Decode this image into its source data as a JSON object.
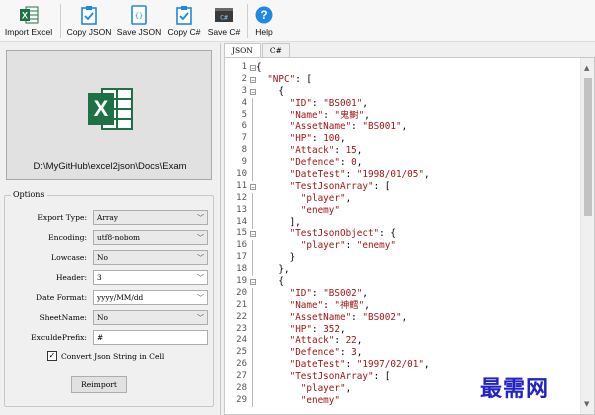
{
  "toolbar": {
    "buttons": [
      {
        "label": "Import Excel",
        "icon": "excel-icon"
      },
      {
        "label": "Copy JSON",
        "icon": "clipboard-check-icon"
      },
      {
        "label": "Save JSON",
        "icon": "json-file-icon"
      },
      {
        "label": "Copy C#",
        "icon": "clipboard-check-icon"
      },
      {
        "label": "Save C#",
        "icon": "csharp-file-icon"
      },
      {
        "label": "Help",
        "icon": "help-icon"
      }
    ]
  },
  "dropzone": {
    "path": "D:\\MyGitHub\\excel2json\\Docs\\Exam",
    "icon": "excel-logo-icon"
  },
  "options": {
    "legend": "Options",
    "export_type": {
      "label": "Export Type:",
      "value": "Array"
    },
    "encoding": {
      "label": "Encoding:",
      "value": "utf8-nobom"
    },
    "lowcase": {
      "label": "Lowcase:",
      "value": "No"
    },
    "header": {
      "label": "Header:",
      "value": "3"
    },
    "date_format": {
      "label": "Date Format:",
      "value": "yyyy/MM/dd"
    },
    "sheet_name": {
      "label": "SheetName:",
      "value": "No"
    },
    "exclude_prefix": {
      "label": "ExculdePrefix:",
      "value": "#"
    },
    "convert_json": {
      "label": "Convert Json String in Cell",
      "checked": true
    },
    "reimport_label": "Reimport"
  },
  "editor": {
    "tabs": [
      "JSON",
      "C#"
    ],
    "active_tab": "JSON",
    "lines": [
      "{",
      "  \"NPC\": [",
      "    {",
      "      \"ID\": \"BS001\",",
      "      \"Name\": \"鬼鲥\",",
      "      \"AssetName\": \"BS001\",",
      "      \"HP\": 100,",
      "      \"Attack\": 15,",
      "      \"Defence\": 0,",
      "      \"DateTest\": \"1998/01/05\",",
      "      \"TestJsonArray\": [",
      "        \"player\",",
      "        \"enemy\"",
      "      ],",
      "      \"TestJsonObject\": {",
      "        \"player\": \"enemy\"",
      "      }",
      "    },",
      "    {",
      "      \"ID\": \"BS002\",",
      "      \"Name\": \"神鳕\",",
      "      \"AssetName\": \"BS002\",",
      "      \"HP\": 352,",
      "      \"Attack\": 22,",
      "      \"Defence\": 3,",
      "      \"DateTest\": \"1997/02/01\",",
      "      \"TestJsonArray\": [",
      "        \"player\",",
      "        \"enemy\""
    ],
    "fold_lines": [
      1,
      2,
      3,
      11,
      15,
      19
    ]
  },
  "watermark": "最需网",
  "colors": {
    "excel_green": "#1e7145",
    "string_red": "#a31515",
    "toolbar_blue": "#1e88e5"
  }
}
